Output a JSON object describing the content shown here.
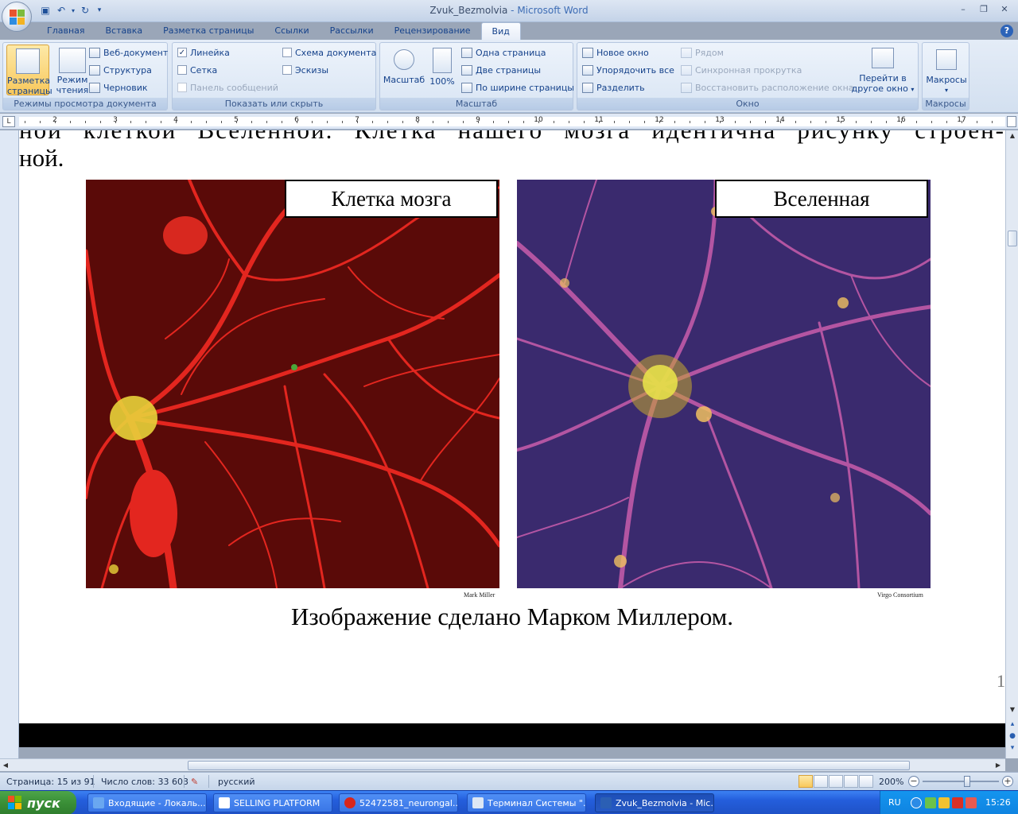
{
  "titlebar": {
    "doc_name": "Zvuk_Bezmolvia",
    "separator": " - ",
    "app_name": "Microsoft Word"
  },
  "ribbon_tabs": [
    "Главная",
    "Вставка",
    "Разметка страницы",
    "Ссылки",
    "Рассылки",
    "Рецензирование",
    "Вид"
  ],
  "ribbon": {
    "views": {
      "label": "Режимы просмотра документа",
      "print_layout_line1": "Разметка",
      "print_layout_line2": "страницы",
      "reading_line1": "Режим",
      "reading_line2": "чтения",
      "web": "Веб-документ",
      "outline": "Структура",
      "draft": "Черновик"
    },
    "show_hide": {
      "label": "Показать или скрыть",
      "ruler": "Линейка",
      "ruler_checked": "✓",
      "gridlines": "Сетка",
      "message_bar": "Панель сообщений",
      "doc_map": "Схема документа",
      "thumbnails": "Эскизы"
    },
    "zoom": {
      "label": "Масштаб",
      "zoom": "Масштаб",
      "percent": "100%",
      "one_page": "Одна страница",
      "two_pages": "Две страницы",
      "page_width": "По ширине страницы"
    },
    "window": {
      "label": "Окно",
      "new_window": "Новое окно",
      "arrange_all": "Упорядочить все",
      "split": "Разделить",
      "side_by_side": "Рядом",
      "sync_scroll": "Синхронная прокрутка",
      "reset_position": "Восстановить расположение окна",
      "switch_line1": "Перейти в",
      "switch_line2": "другое окно"
    },
    "macros": {
      "label": "Макросы",
      "button": "Макросы"
    }
  },
  "ruler": {
    "corner": "L",
    "numbers": [
      "2",
      "3",
      "4",
      "5",
      "6",
      "7",
      "8",
      "9",
      "10",
      "11",
      "12",
      "13",
      "14",
      "15",
      "16",
      "17"
    ]
  },
  "document": {
    "cut_line": "ной клеткой Вселенной. Клетка нашего мозга идентична рисунку строен-",
    "line2": "ной.",
    "figure_left_label": "Клетка мозга",
    "figure_left_credit": "Mark Miller",
    "figure_right_label": "Вселенная",
    "figure_right_credit": "Virgo Consortium",
    "caption": "Изображение сделано Марком Миллером.",
    "page_number": "1"
  },
  "statusbar": {
    "page": "Страница: 15 из 91",
    "words": "Число слов: 33 603",
    "language": "русский",
    "zoom": "200%"
  },
  "taskbar": {
    "start": "пуск",
    "tasks": [
      {
        "label": "Входящие - Локаль...",
        "color": "#6aa7f0"
      },
      {
        "label": "SELLING PLATFORM",
        "color": "#ffffff"
      },
      {
        "label": "52472581_neurongal...",
        "color": "#d8261c"
      },
      {
        "label": "Терминал Системы \"...",
        "color": "#dde7f4"
      },
      {
        "label": "Zvuk_Bezmolvia - Mic...",
        "color": "#2b5fb4"
      }
    ],
    "lang": "RU",
    "time": "15:26"
  }
}
